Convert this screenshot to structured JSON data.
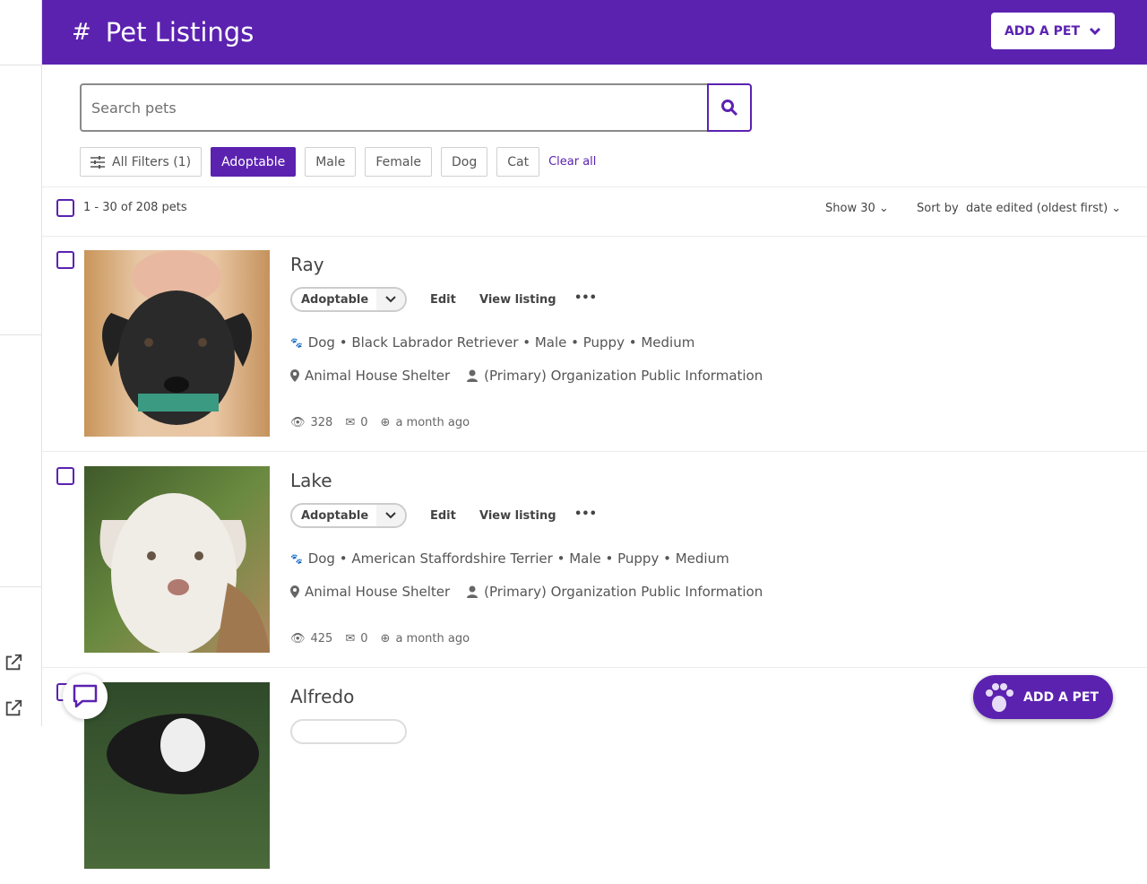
{
  "header": {
    "title": "Pet Listings",
    "hash": "#",
    "add_pet": "ADD A PET"
  },
  "search": {
    "placeholder": "Search pets"
  },
  "filters": {
    "all": "All Filters (1)",
    "chips": [
      "Adoptable",
      "Male",
      "Female",
      "Dog",
      "Cat"
    ],
    "clear": "Clear all"
  },
  "list": {
    "count": "1 - 30 of 208 pets",
    "show": "Show 30",
    "sort_label": "Sort by",
    "sort_value": "date edited (oldest first)"
  },
  "actions": {
    "edit": "Edit",
    "view": "View listing",
    "more": "•••"
  },
  "pets": [
    {
      "name": "Ray",
      "status": "Adoptable",
      "details": "Dog • Black Labrador Retriever • Male • Puppy • Medium",
      "location": "Animal House Shelter",
      "contact": "(Primary) Organization Public Information",
      "views": "328",
      "messages": "0",
      "updated": "a month ago"
    },
    {
      "name": "Lake",
      "status": "Adoptable",
      "details": "Dog • American Staffordshire Terrier • Male • Puppy • Medium",
      "location": "Animal House Shelter",
      "contact": "(Primary) Organization Public Information",
      "views": "425",
      "messages": "0",
      "updated": "a month ago"
    },
    {
      "name": "Alfredo"
    }
  ],
  "fab": {
    "label": "ADD A PET"
  },
  "colors": {
    "brand": "#5b22b0"
  }
}
